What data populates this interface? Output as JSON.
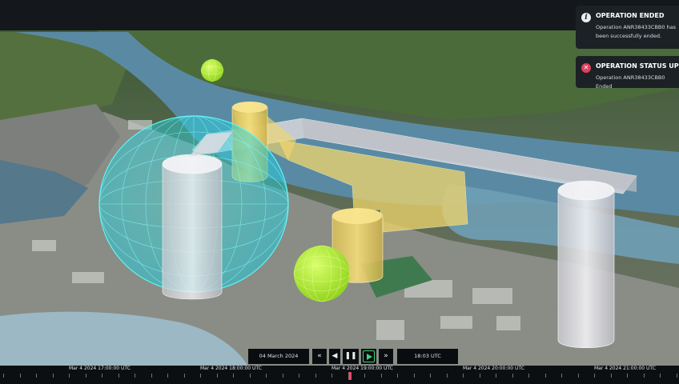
{
  "notifications": [
    {
      "icon": "info-icon",
      "title": "OPERATION ENDED",
      "body": "Operation ANR38433CBB0 has been successfully ended.",
      "accent": "#e9eef2"
    },
    {
      "icon": "close-circle-icon",
      "title": "OPERATION STATUS UPDATE",
      "body": "Operation ANR38433CBB0 Ended",
      "accent": "#e0405e"
    }
  ],
  "playback": {
    "date": "04 March 2024",
    "time": "18:03 UTC",
    "step_back_glyph": "«",
    "prev_glyph": "◀",
    "pause_glyph": "❚❚",
    "step_fwd_glyph": "»",
    "play_color": "#3fd07a"
  },
  "timeline": {
    "ticks": [
      "Mar 4 2024 17:00:00 UTC",
      "Mar 4 2024 18:00:00 UTC",
      "Mar 4 2024 19:00:00 UTC",
      "Mar 4 2024 20:00:00 UTC",
      "Mar 4 2024 21:00:00 UTC"
    ],
    "playhead_color": "#e84c6a"
  },
  "colors": {
    "gray_volume": "#e6e6ea",
    "yellow_volume": "#f0d66b",
    "cyan_sphere": "#2ee8e8",
    "green_sphere": "#b6ff2a",
    "water": "#4f7f9a"
  }
}
